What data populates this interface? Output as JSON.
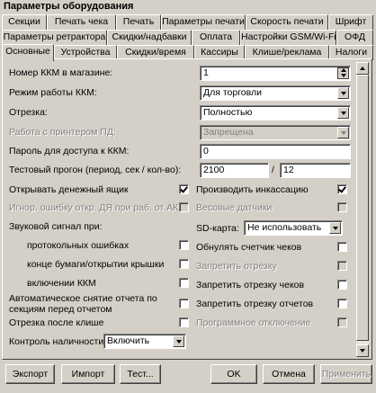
{
  "window": {
    "title": "Параметры оборудования"
  },
  "tabs": {
    "row1": [
      "Секции",
      "Печать чека",
      "Печать",
      "Параметры печати",
      "Скорость печати",
      "Шрифт"
    ],
    "row2": [
      "Параметры ретрактора",
      "Скидки/надбавки",
      "Оплата",
      "Настройки GSM/Wi-Fi",
      "ОФД"
    ],
    "row3": [
      "Основные",
      "Устройства",
      "Скидки/время",
      "Кассиры",
      "Клише/реклама",
      "Налоги"
    ],
    "active": "Основные"
  },
  "form": {
    "kkm_number": {
      "label": "Номер ККМ в магазине:",
      "value": "1"
    },
    "mode": {
      "label": "Режим работы ККМ:",
      "value": "Для торговли"
    },
    "cut": {
      "label": "Отрезка:",
      "value": "Полностью"
    },
    "printer_work": {
      "label": "Работа с принтером ПД:",
      "value": "Запрещена"
    },
    "password": {
      "label": "Пароль для доступа к ККМ:",
      "value": "0"
    },
    "test_run": {
      "label": "Тестовый прогон (период, сек / кол-во):",
      "period": "2100",
      "separator": "/",
      "count": "12"
    },
    "open_drawer": {
      "label": "Открывать денежный ящик",
      "checked": true
    },
    "ignore_fn_error": {
      "label": "Игнор. ошибку откр. ДЯ при раб. от АКБ",
      "checked": false
    },
    "sound_signal": {
      "label": "Звуковой сигнал при:"
    },
    "protocol_errors": {
      "label": "протокольных ошибках",
      "checked": false
    },
    "paper_end": {
      "label": "конце бумаги/открытии крышки",
      "checked": false
    },
    "kkm_on": {
      "label": "включении ККМ",
      "checked": false
    },
    "auto_report": {
      "label": "Автоматическое снятие отчета по секциям перед отчетом",
      "checked": false
    },
    "cut_after_cliche": {
      "label": "Отрезка после клише",
      "checked": false
    },
    "cash_control": {
      "label": "Контроль наличности:",
      "value": "Включить"
    },
    "collection": {
      "label": "Производить инкассацию",
      "checked": true
    },
    "weight_sensors": {
      "label": "Весовые датчики",
      "checked": false
    },
    "sd_card": {
      "label": "SD-карта:",
      "value": "Не использовать"
    },
    "reset_counter": {
      "label": "Обнулять счетчик чеков",
      "checked": false
    },
    "forbid_cut": {
      "label": "Запретить отрезку",
      "checked": false
    },
    "forbid_cut_checks": {
      "label": "Запретить отрезку чеков",
      "checked": false
    },
    "forbid_cut_reports": {
      "label": "Запретить отрезку отчетов",
      "checked": false
    },
    "program_off": {
      "label": "Программное отключение",
      "checked": false
    }
  },
  "buttons": {
    "export": "Экспорт",
    "import": "Импорт",
    "test": "Тест...",
    "ok": "OK",
    "cancel": "Отмена",
    "apply": "Применить"
  }
}
